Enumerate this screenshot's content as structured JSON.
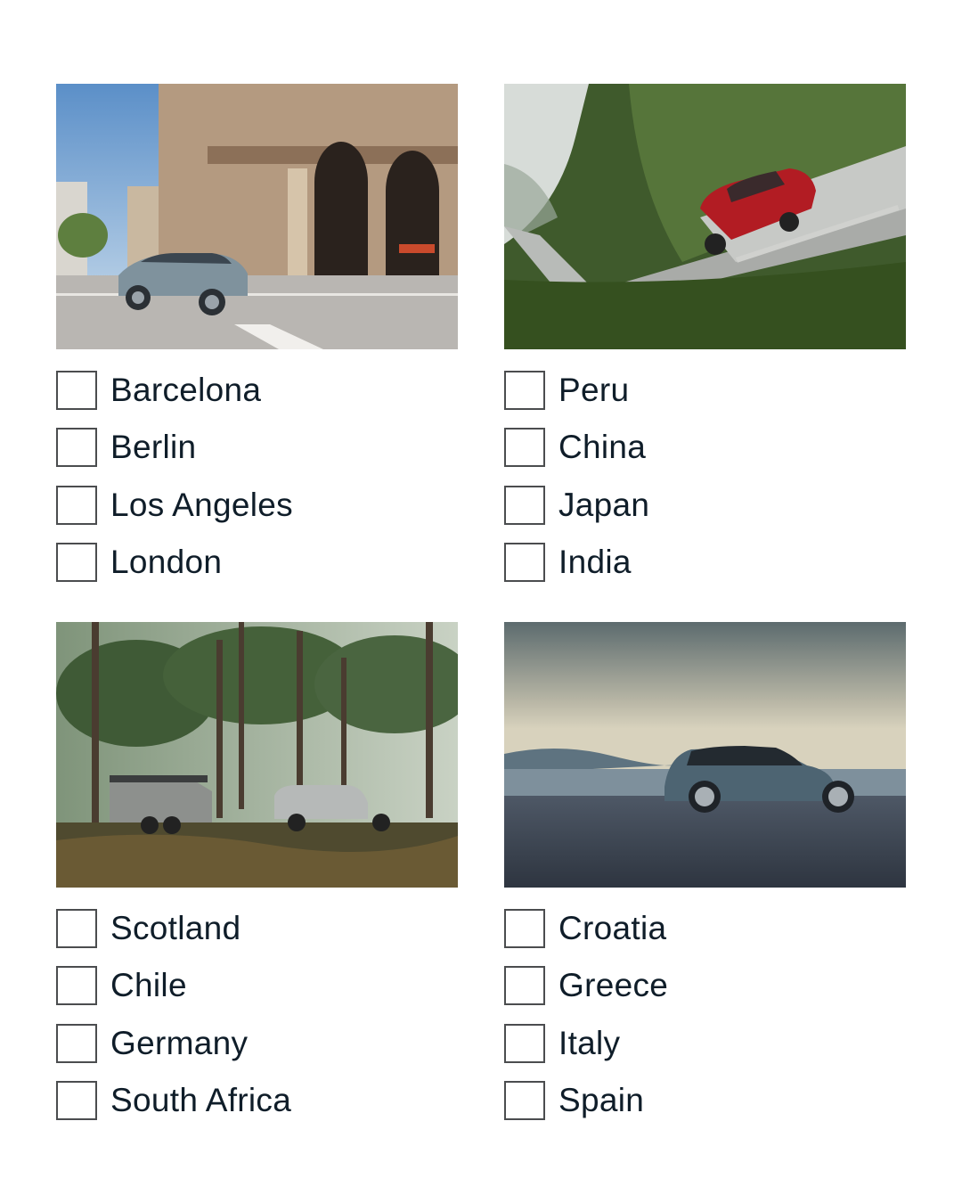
{
  "panels": [
    {
      "image": {
        "alt": "Grey compact SUV turning at a sunny city street corner beside an ornate stone building",
        "icon": "photo-city-street"
      },
      "options": [
        {
          "label": "Barcelona",
          "checked": false
        },
        {
          "label": "Berlin",
          "checked": false
        },
        {
          "label": "Los Angeles",
          "checked": false
        },
        {
          "label": "London",
          "checked": false
        }
      ]
    },
    {
      "image": {
        "alt": "Red SUV climbing a steep stone stairway on a misty green mountainside",
        "icon": "photo-mountain-stairs"
      },
      "options": [
        {
          "label": "Peru",
          "checked": false
        },
        {
          "label": "China",
          "checked": false
        },
        {
          "label": "Japan",
          "checked": false
        },
        {
          "label": "India",
          "checked": false
        }
      ]
    },
    {
      "image": {
        "alt": "Silver off-road SUV towing a camper trailer through a sunlit pine forest",
        "icon": "photo-pine-forest"
      },
      "options": [
        {
          "label": "Scotland",
          "checked": false
        },
        {
          "label": "Chile",
          "checked": false
        },
        {
          "label": "Germany",
          "checked": false
        },
        {
          "label": "South Africa",
          "checked": false
        }
      ]
    },
    {
      "image": {
        "alt": "Blue-grey SUV parked on a waterfront with a coastal town and cloudy sky behind",
        "icon": "photo-coastal-dusk"
      },
      "options": [
        {
          "label": "Croatia",
          "checked": false
        },
        {
          "label": "Greece",
          "checked": false
        },
        {
          "label": "Italy",
          "checked": false
        },
        {
          "label": "Spain",
          "checked": false
        }
      ]
    }
  ]
}
